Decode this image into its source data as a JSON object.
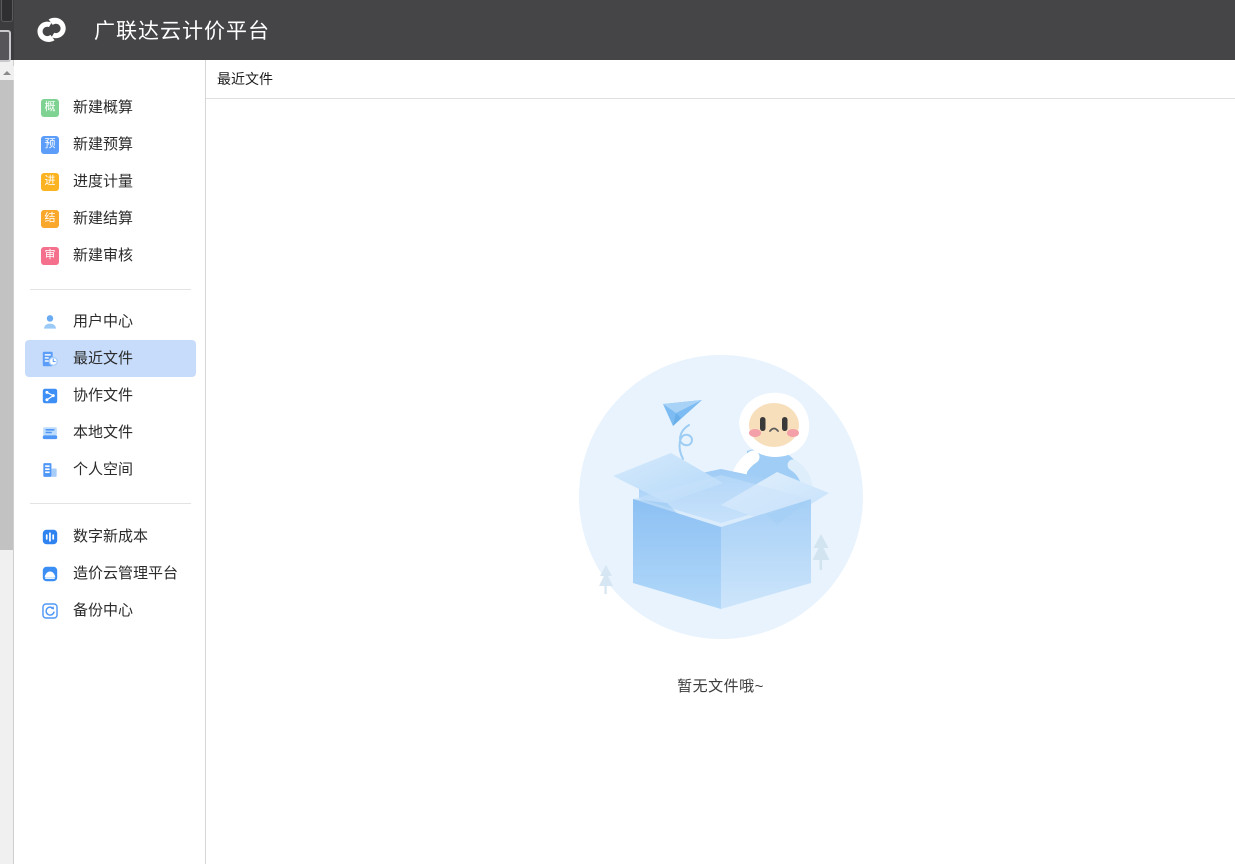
{
  "window": {
    "app_title": "广联达云计价平台",
    "logo_name": "guanglianda-cloud-logo"
  },
  "sidebar": {
    "groups": [
      {
        "id": "create-group",
        "items": [
          {
            "label": "新建概算",
            "icon_name": "gai-square-icon",
            "icon_char": "概",
            "icon_color": "#7ed392"
          },
          {
            "label": "新建预算",
            "icon_name": "yu-square-icon",
            "icon_char": "预",
            "icon_color": "#5b9df9"
          },
          {
            "label": "进度计量",
            "icon_name": "jin-square-icon",
            "icon_char": "进",
            "icon_color": "#fcb322"
          },
          {
            "label": "新建结算",
            "icon_name": "jie-square-icon",
            "icon_char": "结",
            "icon_color": "#f9a82c"
          },
          {
            "label": "新建审核",
            "icon_name": "shen-square-icon",
            "icon_char": "审",
            "icon_color": "#f4708c"
          }
        ]
      },
      {
        "id": "files-group",
        "items": [
          {
            "label": "用户中心",
            "icon_name": "user-icon",
            "selected": false
          },
          {
            "label": "最近文件",
            "icon_name": "recent-files-icon",
            "selected": true
          },
          {
            "label": "协作文件",
            "icon_name": "collaboration-files-icon",
            "selected": false
          },
          {
            "label": "本地文件",
            "icon_name": "local-files-icon",
            "selected": false
          },
          {
            "label": "个人空间",
            "icon_name": "personal-space-icon",
            "selected": false
          }
        ]
      },
      {
        "id": "tools-group",
        "items": [
          {
            "label": "数字新成本",
            "icon_name": "digital-cost-icon"
          },
          {
            "label": "造价云管理平台",
            "icon_name": "cost-cloud-platform-icon"
          },
          {
            "label": "备份中心",
            "icon_name": "backup-center-icon"
          }
        ]
      }
    ]
  },
  "main": {
    "header_title": "最近文件",
    "empty_state": {
      "text": "暂无文件哦~",
      "illustration_name": "empty-box-illustration"
    }
  },
  "colors": {
    "titlebar_bg": "#454548",
    "selected_item_bg": "#c7dcfb",
    "accent_blue": "#5b9df9",
    "illustration_circle": "#e8f3fe",
    "illustration_box": "#a8d1f7"
  }
}
